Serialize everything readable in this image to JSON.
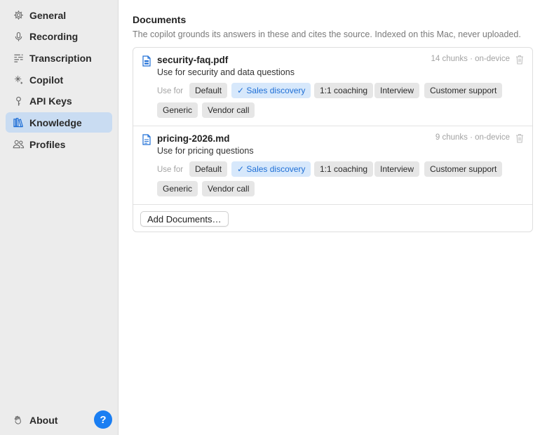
{
  "sidebar": {
    "items": [
      {
        "label": "General",
        "icon": "gear-icon",
        "active": false
      },
      {
        "label": "Recording",
        "icon": "microphone-icon",
        "active": false
      },
      {
        "label": "Transcription",
        "icon": "transcript-lines-icon",
        "active": false
      },
      {
        "label": "Copilot",
        "icon": "sparkle-icon",
        "active": false
      },
      {
        "label": "API Keys",
        "icon": "key-icon",
        "active": false
      },
      {
        "label": "Knowledge",
        "icon": "library-books-icon",
        "active": true
      },
      {
        "label": "Profiles",
        "icon": "people-icon",
        "active": false
      }
    ],
    "about": {
      "label": "About",
      "icon": "hand-wave-icon"
    },
    "help": {
      "label": "?"
    }
  },
  "main": {
    "title": "Documents",
    "description": "The copilot grounds its answers in these and cites the source. Indexed on this Mac, never uploaded.",
    "use_for_label": "Use for",
    "documents": [
      {
        "name": "security-faq.pdf",
        "use": "Use for security and data questions",
        "meta": "14 chunks · on-device",
        "icon": "pdf-file-icon",
        "tags": [
          {
            "label": "Default",
            "selected": false
          },
          {
            "label": "✓ Sales discovery",
            "selected": true
          },
          {
            "label": "1:1 coaching",
            "selected": false
          },
          {
            "label": "Interview",
            "selected": false
          },
          {
            "label": "Customer support",
            "selected": false
          },
          {
            "label": "Generic",
            "selected": false
          },
          {
            "label": "Vendor call",
            "selected": false
          }
        ]
      },
      {
        "name": "pricing-2026.md",
        "use": "Use for pricing questions",
        "meta": "9 chunks · on-device",
        "icon": "text-file-icon",
        "tags": [
          {
            "label": "Default",
            "selected": false
          },
          {
            "label": "✓ Sales discovery",
            "selected": true
          },
          {
            "label": "1:1 coaching",
            "selected": false
          },
          {
            "label": "Interview",
            "selected": false
          },
          {
            "label": "Customer support",
            "selected": false
          },
          {
            "label": "Generic",
            "selected": false
          },
          {
            "label": "Vendor call",
            "selected": false
          }
        ]
      }
    ],
    "add_button": "Add Documents…"
  },
  "colors": {
    "accent": "#1f6fd6",
    "sidebar_bg": "#ececec",
    "active_item_bg": "#c9dcf2",
    "tag_bg": "#e6e6e6",
    "tag_selected_bg": "#d7e8fb",
    "help_button": "#1a7ef2"
  }
}
